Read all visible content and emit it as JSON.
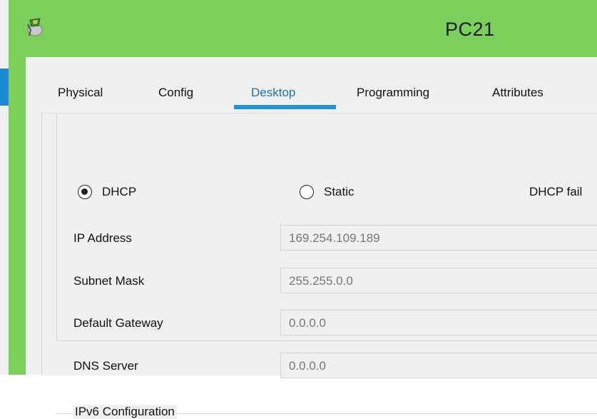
{
  "window": {
    "title": "PC21"
  },
  "tabs": [
    {
      "label": "Physical"
    },
    {
      "label": "Config"
    },
    {
      "label": "Desktop",
      "active": true
    },
    {
      "label": "Programming"
    },
    {
      "label": "Attributes"
    }
  ],
  "ip_config": {
    "dhcp_label": "DHCP",
    "dhcp_selected": true,
    "static_label": "Static",
    "status_text": "DHCP fail",
    "fields": [
      {
        "label": "IP Address",
        "value": "169.254.109.189"
      },
      {
        "label": "Subnet Mask",
        "value": "255.255.0.0"
      },
      {
        "label": "Default Gateway",
        "value": "0.0.0.0"
      },
      {
        "label": "DNS Server",
        "value": "0.0.0.0"
      }
    ]
  },
  "ipv6": {
    "legend": "IPv6 Configuration"
  },
  "colors": {
    "title_bar": "#7ccf5a",
    "accent": "#1e96d6",
    "client_bg": "#f0f0f0"
  },
  "icons": {
    "app": "packet-tracer-pc-icon"
  }
}
